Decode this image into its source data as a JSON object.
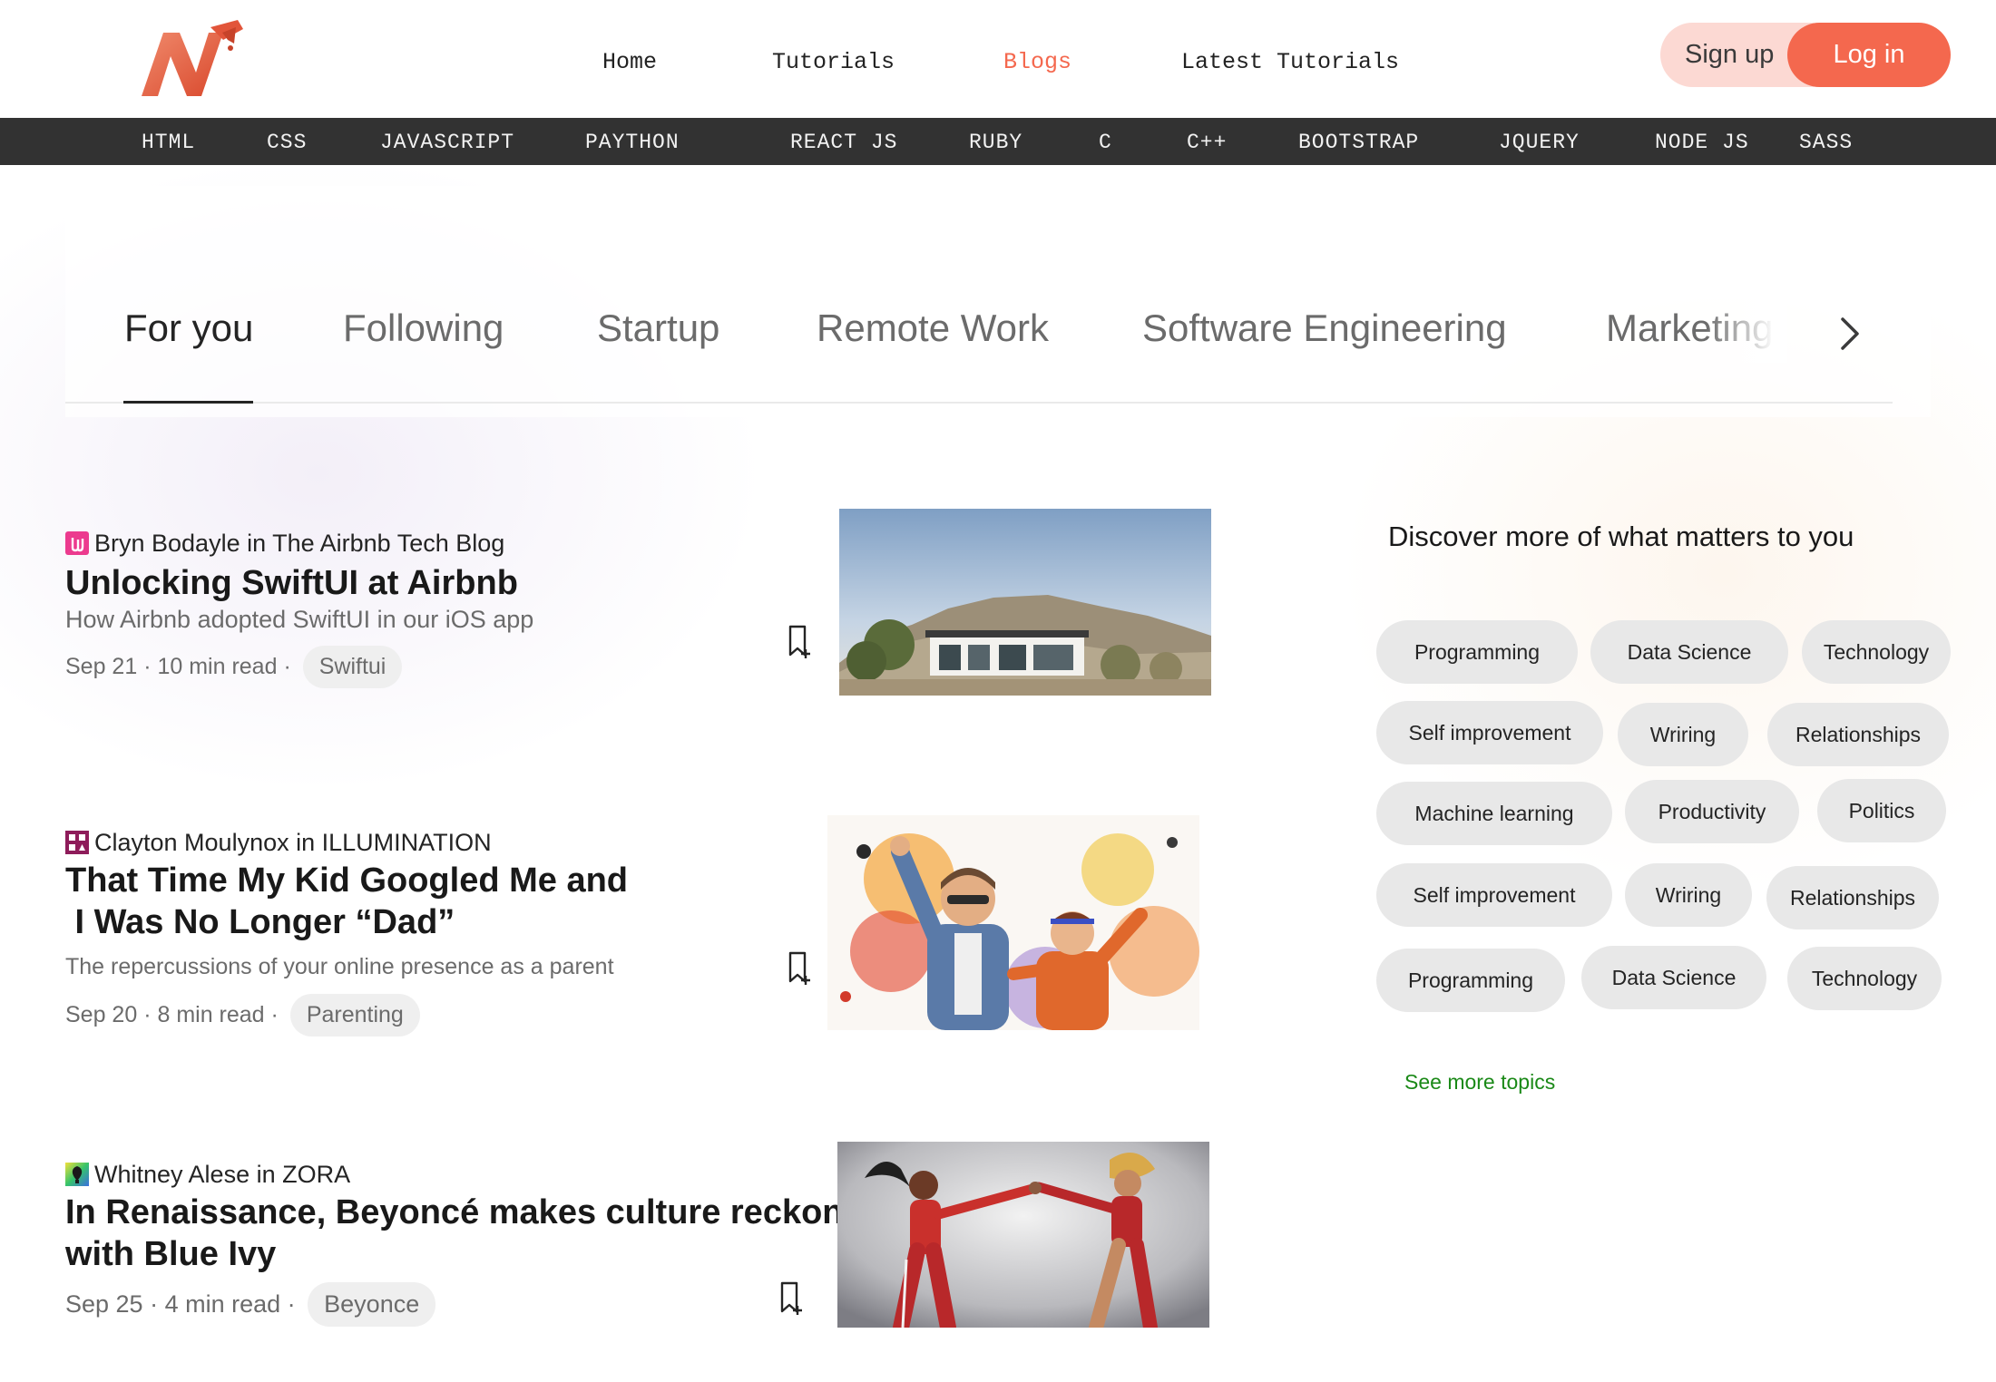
{
  "header": {
    "logo_icon": "brand-n-logo-icon",
    "nav": [
      "Home",
      "Tutorials",
      "Blogs",
      "Latest Tutorials"
    ],
    "active_nav": "Blogs",
    "signup_label": "Sign up",
    "login_label": "Log in",
    "accent_color": "#f4684e"
  },
  "categories": [
    "HTML",
    "CSS",
    "JAVASCRIPT",
    "PAYTHON",
    "REACT JS",
    "RUBY",
    "C",
    "C++",
    "BOOTSTRAP",
    "JQUERY",
    "NODE JS",
    "SASS"
  ],
  "tabs": {
    "items": [
      "For you",
      "Following",
      "Startup",
      "Remote Work",
      "Software Engineering",
      "Marketing"
    ],
    "active": "For you",
    "next_icon": "chevron-right-icon"
  },
  "articles": [
    {
      "author": "Bryn Bodayle in The Airbnb Tech Blog",
      "title_lines": [
        "Unlocking SwiftUI at Airbnb"
      ],
      "subtitle": "How Airbnb adopted SwiftUI in our iOS app",
      "date": "Sep 21",
      "read_time": "10 min read",
      "tag": "Swiftui",
      "bookmark_icon": "bookmark-add-icon"
    },
    {
      "author": "Clayton Moulynox in ILLUMINATION",
      "title_lines": [
        "That Time My Kid Googled Me and",
        " I Was No Longer “Dad”"
      ],
      "subtitle": "The repercussions of your online presence as a parent",
      "date": "Sep 20",
      "read_time": "8 min read",
      "tag": "Parenting",
      "bookmark_icon": "bookmark-add-icon"
    },
    {
      "author": "Whitney Alese in ZORA",
      "title_lines": [
        "In Renaissance, Beyoncé makes culture reckon",
        "with Blue Ivy"
      ],
      "subtitle": "",
      "date": "Sep 25",
      "read_time": "4 min read",
      "tag": "Beyonce",
      "bookmark_icon": "bookmark-add-icon"
    }
  ],
  "sidebar": {
    "title": "Discover more of what matters to you",
    "topics": [
      "Programming",
      "Data Science",
      "Technology",
      "Self improvement",
      "Wriring",
      "Relationships",
      "Machine learning",
      "Productivity",
      "Politics",
      "Self improvement",
      "Wriring",
      "Relationships",
      "Programming",
      "Data Science",
      "Technology"
    ],
    "see_more": "See more topics",
    "link_color": "#1a8917"
  }
}
